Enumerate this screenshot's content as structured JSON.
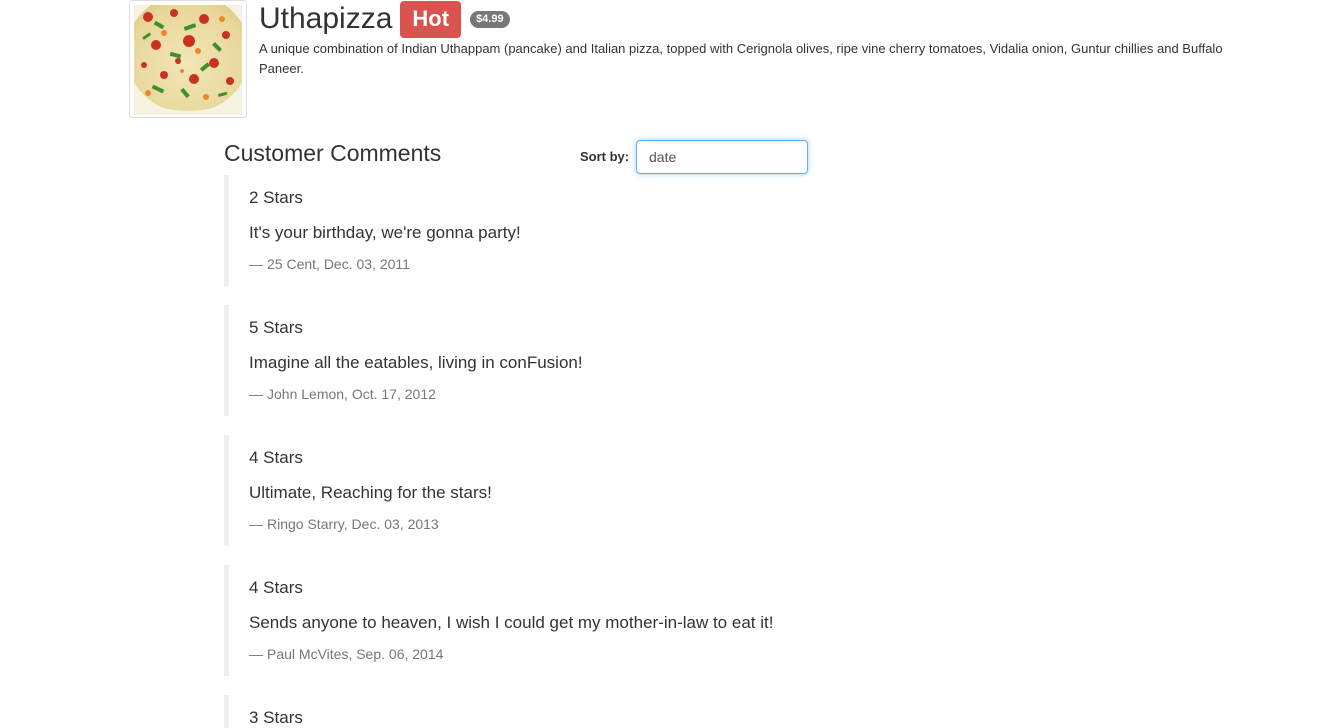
{
  "dish": {
    "name": "Uthapizza",
    "label": "Hot",
    "price": "$4.99",
    "description": "A unique combination of Indian Uthappam (pancake) and Italian pizza, topped with Cerignola olives, ripe vine cherry tomatoes, Vidalia onion, Guntur chillies and Buffalo Paneer.",
    "image_alt": "Uthapizza"
  },
  "comments_section": {
    "title": "Customer Comments",
    "sort_label": "Sort by:",
    "sort_value": "date"
  },
  "comments": [
    {
      "rating": "2 Stars",
      "comment": "It's your birthday, we're gonna party!",
      "dash": "—",
      "author_date": "25 Cent, Dec. 03, 2011"
    },
    {
      "rating": "5 Stars",
      "comment": "Imagine all the eatables, living in conFusion!",
      "dash": "—",
      "author_date": "John Lemon, Oct. 17, 2012"
    },
    {
      "rating": "4 Stars",
      "comment": "Ultimate, Reaching for the stars!",
      "dash": "—",
      "author_date": "Ringo Starry, Dec. 03, 2013"
    },
    {
      "rating": "4 Stars",
      "comment": "Sends anyone to heaven, I wish I could get my mother-in-law to eat it!",
      "dash": "—",
      "author_date": "Paul McVites, Sep. 06, 2014"
    },
    {
      "rating": "3 Stars"
    }
  ],
  "colors": {
    "hot_badge": "#d9534f",
    "price_badge": "#777777",
    "input_focus_border": "#66afe9",
    "quote_border": "#eeeeee",
    "muted_text": "#777777"
  }
}
